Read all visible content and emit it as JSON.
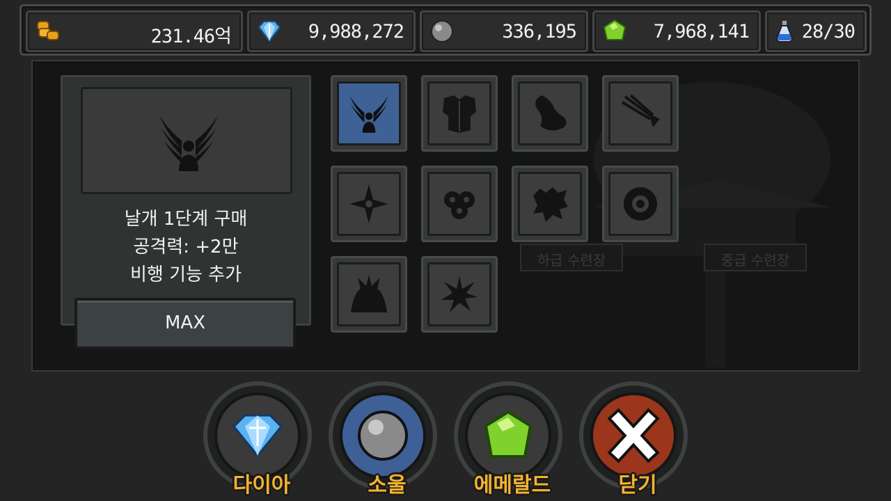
{
  "currencies": [
    {
      "id": "gold",
      "icon": "gold-coins-icon",
      "value": "231.46억"
    },
    {
      "id": "diamond",
      "icon": "diamond-icon",
      "value": "9,988,272"
    },
    {
      "id": "soul",
      "icon": "soul-orb-icon",
      "value": "336,195"
    },
    {
      "id": "emerald",
      "icon": "emerald-icon",
      "value": "7,968,141"
    },
    {
      "id": "potion",
      "icon": "potion-icon",
      "value": "28/30"
    }
  ],
  "background": {
    "sign_lower": "하급 수련장",
    "sign_middle": "중급 수련장"
  },
  "info": {
    "icon": "wings-icon",
    "line1": "날개 1단계 구매",
    "line2": "공격력: +2만",
    "line3": "비행 기능 추가",
    "button": "MAX"
  },
  "skills": [
    {
      "icon": "wings-icon",
      "selected": true
    },
    {
      "icon": "armor-icon",
      "selected": false
    },
    {
      "icon": "flame-claw-icon",
      "selected": false
    },
    {
      "icon": "triple-blade-icon",
      "selected": false
    },
    {
      "icon": "shuriken-icon",
      "selected": false
    },
    {
      "icon": "triskelion-icon",
      "selected": false
    },
    {
      "icon": "beast-icon",
      "selected": false
    },
    {
      "icon": "spiral-icon",
      "selected": false
    },
    {
      "icon": "burst-icon",
      "selected": false
    },
    {
      "icon": "splatter-icon",
      "selected": false
    }
  ],
  "bottom_buttons": {
    "diamond": "다이아",
    "soul": "소울",
    "emerald": "에메랄드",
    "close": "닫기"
  },
  "colors": {
    "label": "#f5b32e",
    "selected_slot": "#3e6296",
    "close_button": "#9b361c"
  }
}
